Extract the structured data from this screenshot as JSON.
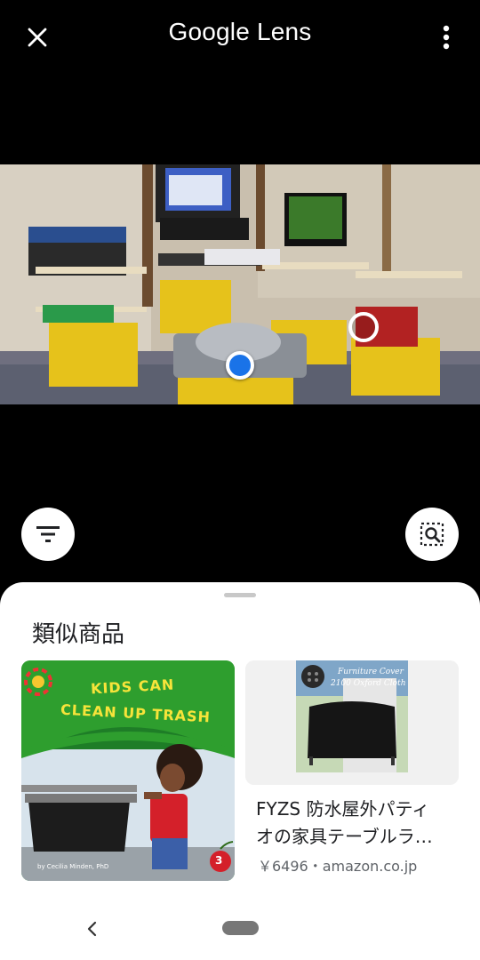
{
  "header": {
    "title": "Google Lens",
    "close_icon": "close-icon",
    "menu_icon": "more-vert-icon"
  },
  "actions": {
    "filter_icon": "filter-icon",
    "select_icon": "region-search-icon"
  },
  "results": {
    "section_title": "類似商品",
    "left_card": {
      "cover_title_line1": "KIDS CAN",
      "cover_title_line2": "CLEAN UP TRASH",
      "cover_author": "by Cecilia Minden, PhD",
      "badge": "3"
    },
    "right_card": {
      "image_caption_line1": "Furniture Cover",
      "image_caption_line2": "2100 Oxford Cloth",
      "title_line1": "FYZS 防水屋外パティ",
      "title_line2": "オの家具テーブルラ…",
      "meta": "￥6496・amazon.co.jp"
    }
  },
  "colors": {
    "accent": "#1a73e8",
    "book_green": "#2e9e2e",
    "title_yellow": "#f7e43a"
  }
}
